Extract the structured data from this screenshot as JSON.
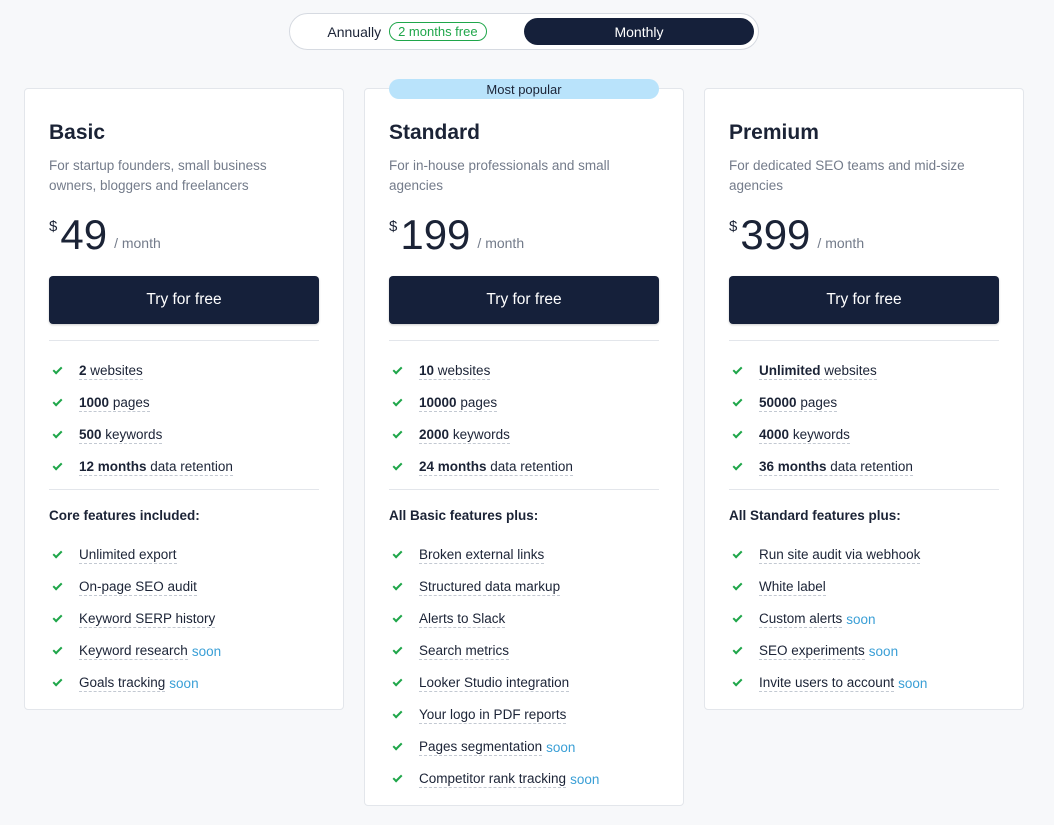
{
  "billing_toggle": {
    "annually_label": "Annually",
    "annually_badge": "2 months free",
    "monthly_label": "Monthly"
  },
  "plans": [
    {
      "name": "Basic",
      "description": "For startup founders, small business owners, bloggers and freelancers",
      "currency": "$",
      "price": "49",
      "period": "/ month",
      "cta": "Try for free",
      "limits": [
        {
          "value": "2",
          "unit": "websites"
        },
        {
          "value": "1000",
          "unit": "pages"
        },
        {
          "value": "500",
          "unit": "keywords"
        },
        {
          "value": "12 months",
          "unit": "data retention"
        }
      ],
      "features_heading": "Core features included:",
      "features": [
        {
          "label": "Unlimited export",
          "tag": ""
        },
        {
          "label": "On-page SEO audit",
          "tag": ""
        },
        {
          "label": "Keyword SERP history",
          "tag": ""
        },
        {
          "label": "Keyword research",
          "tag": "soon"
        },
        {
          "label": "Goals tracking",
          "tag": "soon"
        }
      ]
    },
    {
      "name": "Standard",
      "badge": "Most popular",
      "description": "For in-house professionals and small agencies",
      "currency": "$",
      "price": "199",
      "period": "/ month",
      "cta": "Try for free",
      "limits": [
        {
          "value": "10",
          "unit": "websites"
        },
        {
          "value": "10000",
          "unit": "pages"
        },
        {
          "value": "2000",
          "unit": "keywords"
        },
        {
          "value": "24 months",
          "unit": "data retention"
        }
      ],
      "features_heading": "All Basic features plus:",
      "features": [
        {
          "label": "Broken external links",
          "tag": ""
        },
        {
          "label": "Structured data markup",
          "tag": ""
        },
        {
          "label": "Alerts to Slack",
          "tag": ""
        },
        {
          "label": "Search metrics",
          "tag": ""
        },
        {
          "label": "Looker Studio integration",
          "tag": ""
        },
        {
          "label": "Your logo in PDF reports",
          "tag": ""
        },
        {
          "label": "Pages segmentation",
          "tag": "soon"
        },
        {
          "label": "Competitor rank tracking",
          "tag": "soon"
        }
      ]
    },
    {
      "name": "Premium",
      "description": "For dedicated SEO teams and mid-size agencies",
      "currency": "$",
      "price": "399",
      "period": "/ month",
      "cta": "Try for free",
      "limits": [
        {
          "value": "Unlimited",
          "unit": "websites"
        },
        {
          "value": "50000",
          "unit": "pages"
        },
        {
          "value": "4000",
          "unit": "keywords"
        },
        {
          "value": "36 months",
          "unit": "data retention"
        }
      ],
      "features_heading": "All Standard features plus:",
      "features": [
        {
          "label": "Run site audit via webhook",
          "tag": ""
        },
        {
          "label": "White label",
          "tag": ""
        },
        {
          "label": "Custom alerts",
          "tag": "soon"
        },
        {
          "label": "SEO experiments",
          "tag": "soon"
        },
        {
          "label": "Invite users to account",
          "tag": "soon"
        }
      ]
    }
  ],
  "colors": {
    "accent_dark": "#15203a",
    "check_green": "#1fa64a",
    "soon_blue": "#3a9fd6",
    "popular_badge": "#b9e3fb"
  },
  "icons": {
    "check": "check-icon"
  }
}
